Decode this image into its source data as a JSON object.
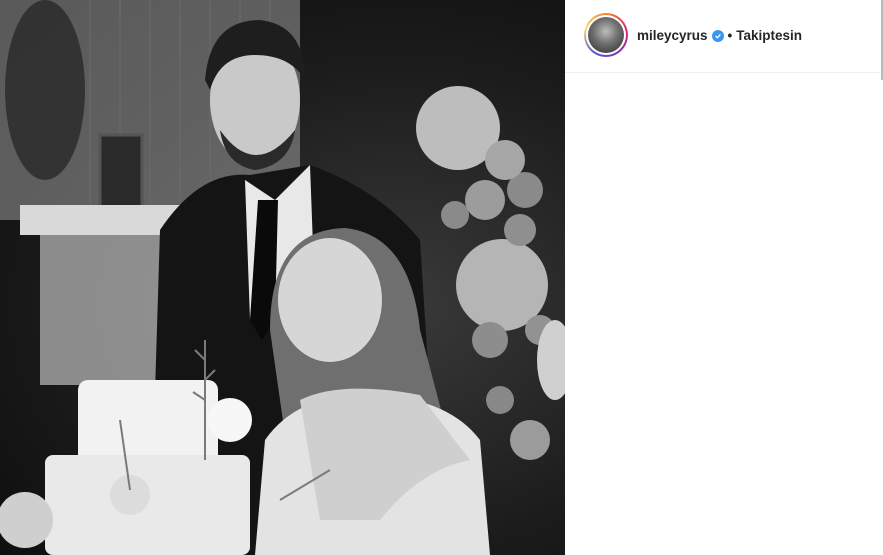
{
  "post": {
    "username": "mileycyrus",
    "verified": true,
    "separator": "•",
    "follow_label": "Takiptesin"
  },
  "photo": {
    "description_icon": "photo-image",
    "style": "black-and-white"
  },
  "colors": {
    "verified_badge": "#3897f0",
    "text": "#262626",
    "divider": "#efefef"
  }
}
